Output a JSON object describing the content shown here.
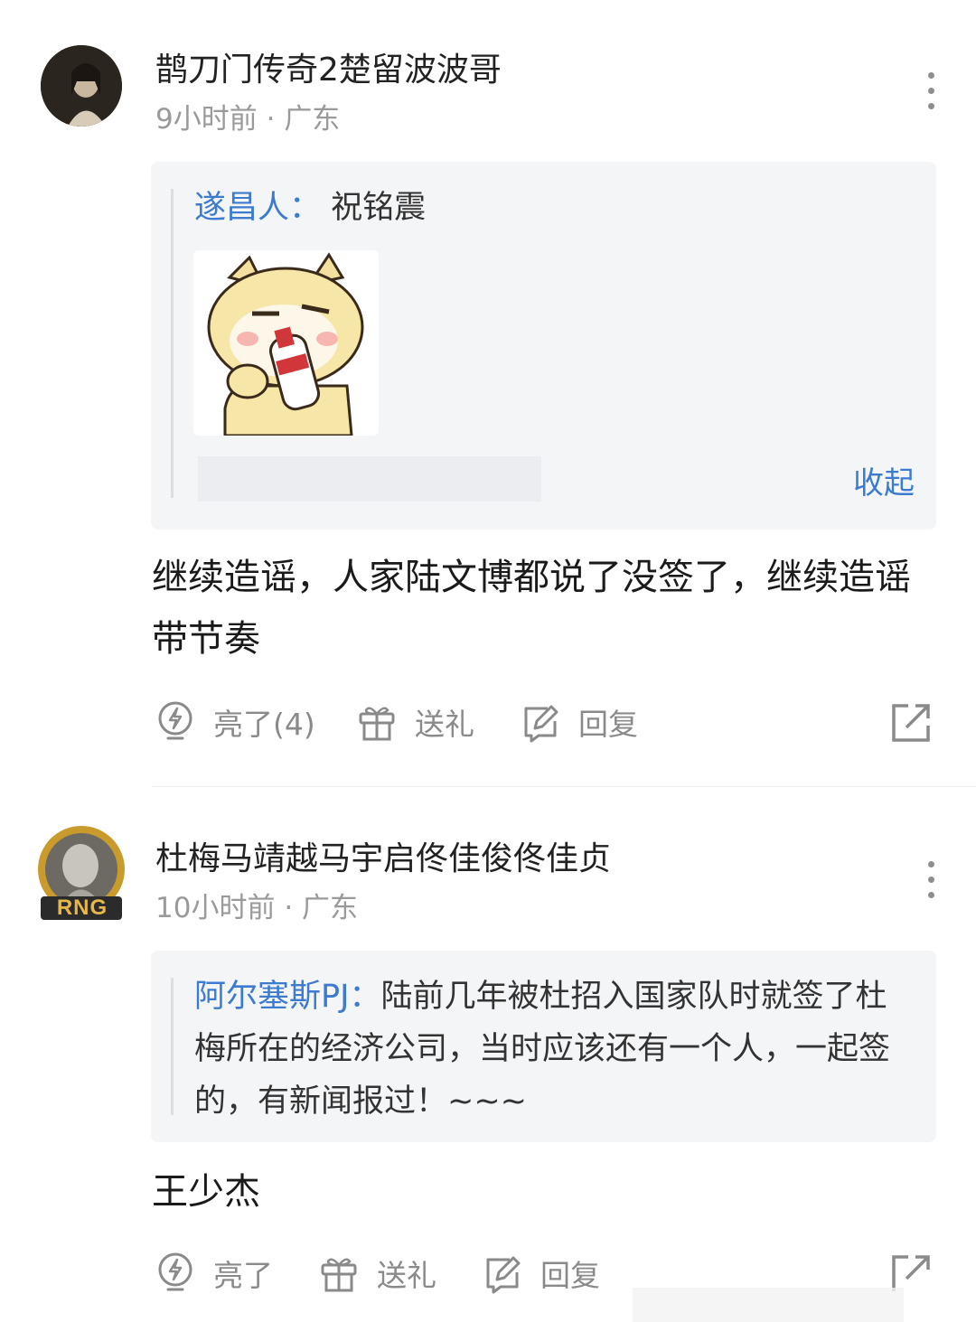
{
  "comments": [
    {
      "username": "鹊刀门传奇2楚留波波哥",
      "time": "9小时前",
      "location": "广东",
      "quote": {
        "author": "遂昌人：",
        "text": "祝铭震",
        "collapse_label": "收起"
      },
      "body": "继续造谣，人家陆文博都说了没签了，继续造谣带节奏",
      "actions": {
        "like": "亮了(4)",
        "gift": "送礼",
        "reply": "回复"
      }
    },
    {
      "username": "杜梅马靖越马宇启佟佳俊佟佳贞",
      "time": "10小时前",
      "location": "广东",
      "badge": "RNG",
      "quote": {
        "author": "阿尔塞斯PJ：",
        "text": "陆前几年被杜招入国家队时就签了杜梅所在的经济公司，当时应该还有一个人，一起签的，有新闻报过！~~~"
      },
      "body": "王少杰",
      "actions": {
        "like": "亮了",
        "gift": "送礼",
        "reply": "回复"
      }
    }
  ],
  "colors": {
    "link_blue": "#3c7bd0",
    "meta_gray": "#9a9a9a",
    "quote_bg": "#f4f5f7"
  },
  "icons": [
    "lightning-bulb-icon",
    "gift-icon",
    "edit-reply-icon",
    "share-icon",
    "more-icon"
  ]
}
